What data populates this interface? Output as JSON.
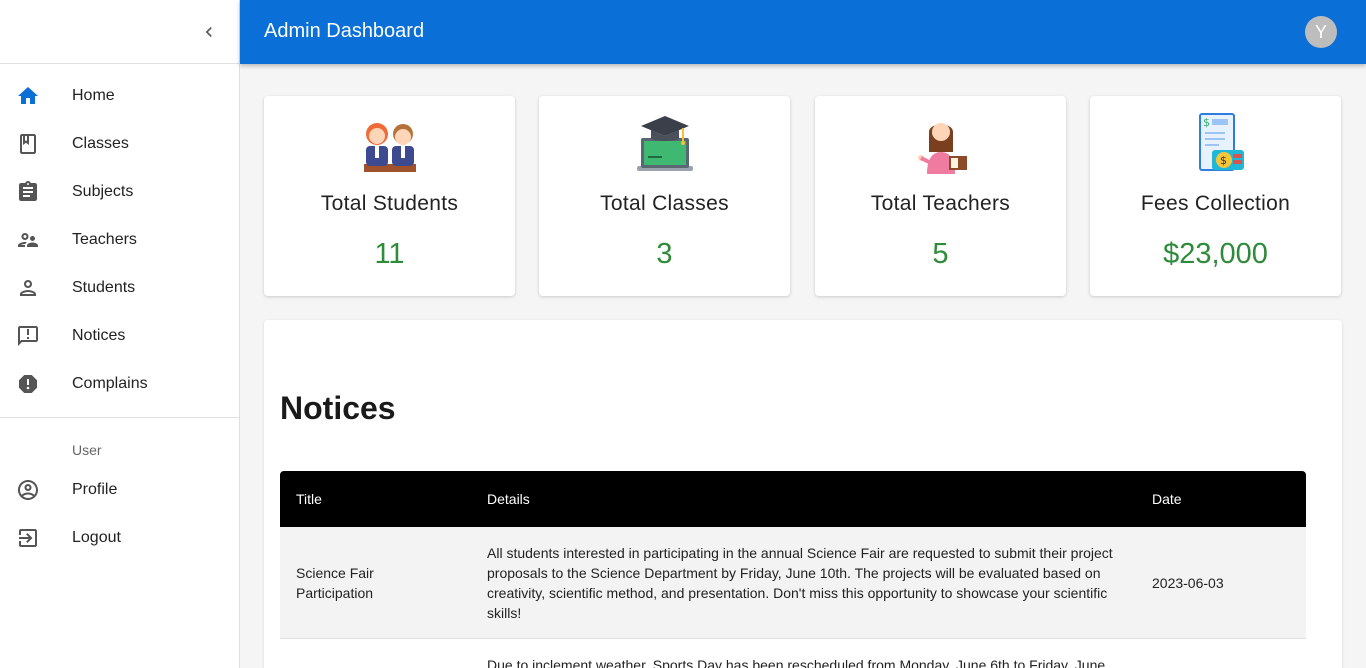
{
  "app": {
    "title": "Admin Dashboard",
    "avatar_initial": "Y"
  },
  "sidebar": {
    "items": [
      {
        "label": "Home",
        "icon": "home-icon"
      },
      {
        "label": "Classes",
        "icon": "book-icon"
      },
      {
        "label": "Subjects",
        "icon": "clipboard-icon"
      },
      {
        "label": "Teachers",
        "icon": "supervisor-icon"
      },
      {
        "label": "Students",
        "icon": "person-icon"
      },
      {
        "label": "Notices",
        "icon": "announcement-icon"
      },
      {
        "label": "Complains",
        "icon": "report-icon"
      }
    ],
    "user_header": "User",
    "user_items": [
      {
        "label": "Profile",
        "icon": "account-circle-icon"
      },
      {
        "label": "Logout",
        "icon": "exit-icon"
      }
    ]
  },
  "stats": [
    {
      "title": "Total Students",
      "value": "11",
      "icon": "students-illustration"
    },
    {
      "title": "Total Classes",
      "value": "3",
      "icon": "graduation-laptop-illustration"
    },
    {
      "title": "Total Teachers",
      "value": "5",
      "icon": "teacher-illustration"
    },
    {
      "title": "Fees Collection",
      "value": "$23,000",
      "icon": "fees-bill-illustration"
    }
  ],
  "notices": {
    "heading": "Notices",
    "columns": [
      "Title",
      "Details",
      "Date"
    ],
    "rows": [
      {
        "title": "Science Fair Participation",
        "details": "All students interested in participating in the annual Science Fair are requested to submit their project proposals to the Science Department by Friday, June 10th. The projects will be evaluated based on creativity, scientific method, and presentation. Don't miss this opportunity to showcase your scientific skills!",
        "date": "2023-06-03"
      },
      {
        "title": "",
        "details": "Due to inclement weather, Sports Day has been rescheduled from Monday, June 6th to Friday, June",
        "date": ""
      }
    ]
  },
  "colors": {
    "appbar": "#0a6fd6",
    "stat_value": "#2e8b3a",
    "table_header": "#000000"
  }
}
